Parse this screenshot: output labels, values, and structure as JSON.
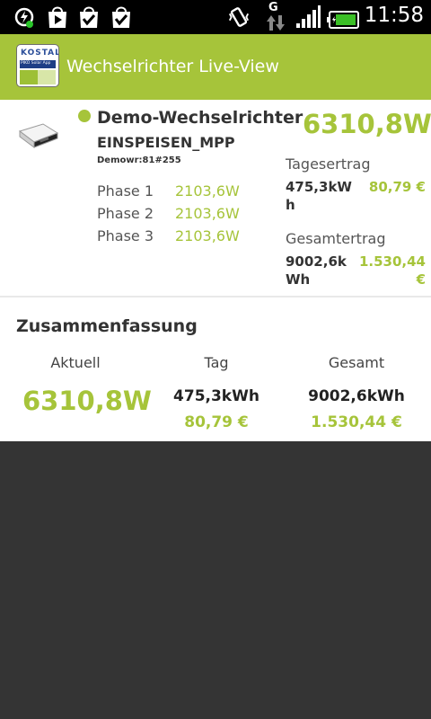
{
  "status_bar": {
    "time": "11:58",
    "network_type": "G",
    "notification_icons": [
      "sync-icon",
      "play-store-icon",
      "task-check-icon",
      "task-check-icon"
    ],
    "system_icons": [
      "vibrate-icon",
      "network-data-icon",
      "signal-icon",
      "battery-icon"
    ]
  },
  "action_bar": {
    "title": "Wechselrichter Live-View",
    "app_icon": {
      "brand": "KOSTAL",
      "subtitle": "PIKO Solar App"
    }
  },
  "device": {
    "name": "Demo-Wechselrichter",
    "state": "EINSPEISEN_MPP",
    "id": "Demowr:81#255",
    "online": true,
    "current_power": "6310,8W",
    "phases": [
      {
        "label": "Phase 1",
        "value": "2103,6W"
      },
      {
        "label": "Phase 2",
        "value": "2103,6W"
      },
      {
        "label": "Phase 3",
        "value": "2103,6W"
      }
    ],
    "daily": {
      "label": "Tagesertrag",
      "kwh": "475,3kWh",
      "eur": "80,79 €"
    },
    "total": {
      "label": "Gesamtertrag",
      "kwh": "9002,6kWh",
      "eur": "1.530,44 €"
    }
  },
  "summary": {
    "title": "Zusammenfassung",
    "current": {
      "label": "Aktuell",
      "value": "6310,8W"
    },
    "day": {
      "label": "Tag",
      "kwh": "475,3kWh",
      "eur": "80,79 €"
    },
    "total": {
      "label": "Gesamt",
      "kwh": "9002,6kWh",
      "eur": "1.530,44 €"
    }
  },
  "colors": {
    "accent": "#a6c43a",
    "status_bar": "#000000",
    "background": "#343434"
  }
}
